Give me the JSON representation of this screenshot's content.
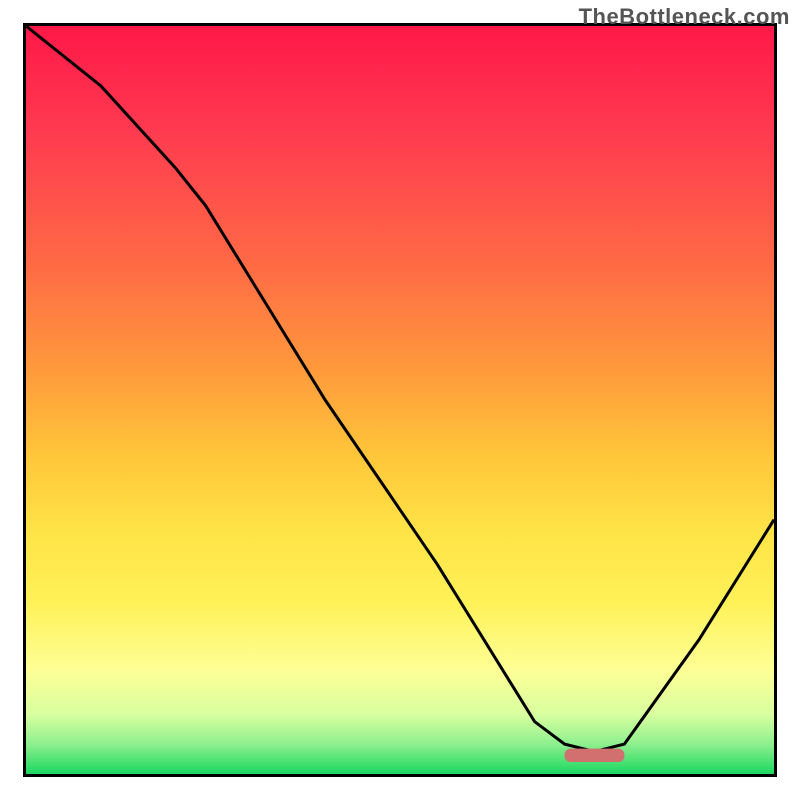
{
  "watermark": "TheBottleneck.com",
  "chart_data": {
    "type": "line",
    "title": "",
    "xlabel": "",
    "ylabel": "",
    "xlim": [
      0,
      100
    ],
    "ylim": [
      0,
      100
    ],
    "grid": false,
    "series": [
      {
        "name": "curve",
        "x": [
          0,
          10,
          20,
          24,
          40,
          55,
          68,
          72,
          76,
          80,
          90,
          100
        ],
        "values": [
          100,
          92,
          81,
          76,
          50,
          28,
          7,
          4,
          3,
          4,
          18,
          34
        ]
      }
    ],
    "marker": {
      "x_start": 72,
      "x_end": 80,
      "y": 2.5,
      "color": "#d27070",
      "shape": "rounded_bar"
    },
    "background_gradient": {
      "orientation": "vertical_top_to_bottom",
      "stops": [
        {
          "pos": 0.0,
          "color": "#ff1848"
        },
        {
          "pos": 0.14,
          "color": "#ff3a50"
        },
        {
          "pos": 0.32,
          "color": "#ff6a45"
        },
        {
          "pos": 0.46,
          "color": "#ff9a3c"
        },
        {
          "pos": 0.58,
          "color": "#ffc83a"
        },
        {
          "pos": 0.68,
          "color": "#ffe447"
        },
        {
          "pos": 0.77,
          "color": "#fff157"
        },
        {
          "pos": 0.86,
          "color": "#feff95"
        },
        {
          "pos": 0.92,
          "color": "#d9ffa0"
        },
        {
          "pos": 0.96,
          "color": "#8ef08e"
        },
        {
          "pos": 1.0,
          "color": "#1bd760"
        }
      ]
    }
  }
}
